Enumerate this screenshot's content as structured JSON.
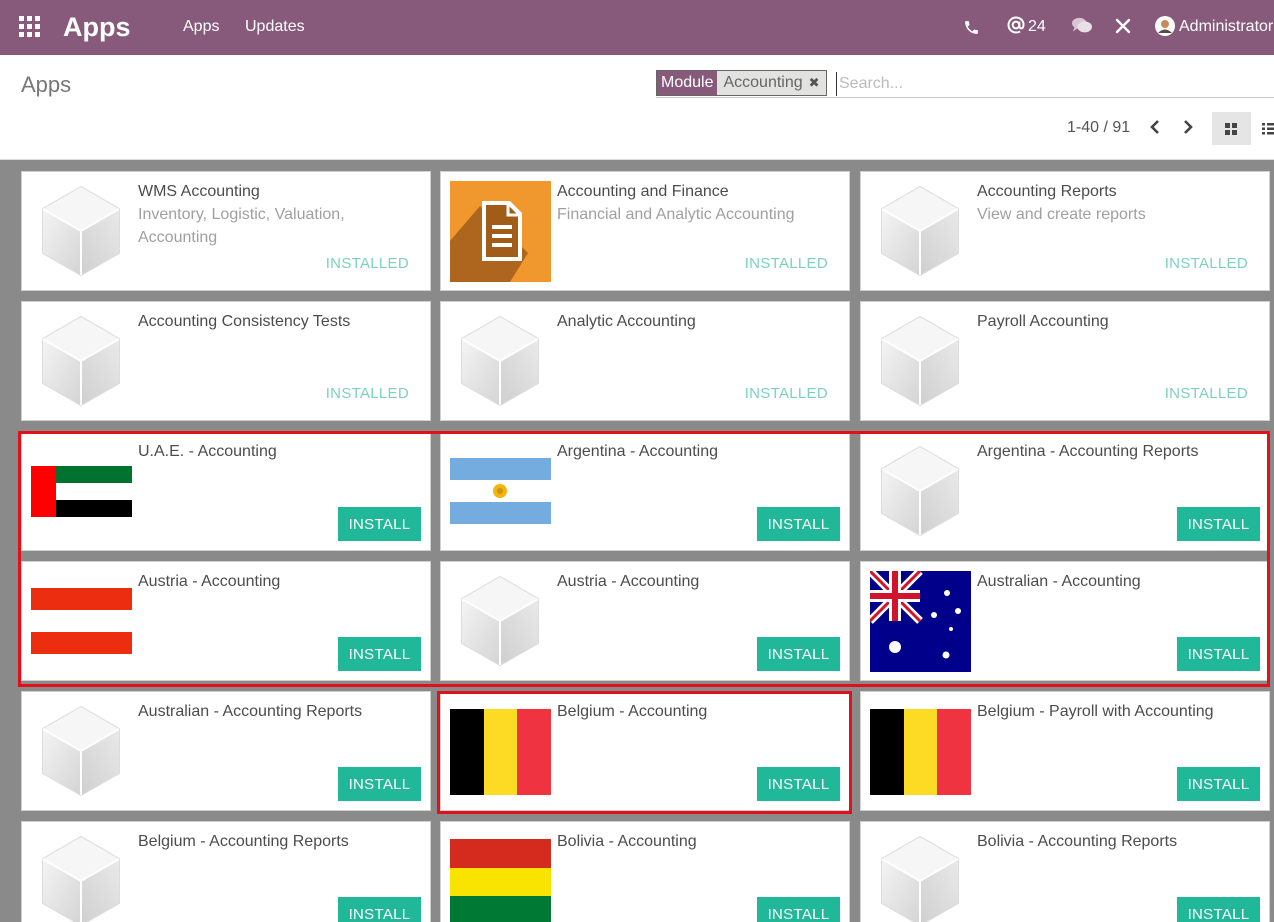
{
  "navbar": {
    "brand": "Apps",
    "menu": [
      "Apps",
      "Updates"
    ],
    "messages_count": "24",
    "user_name": "Administrator",
    "icons": [
      "apps-grid-icon",
      "phone-icon",
      "at-icon",
      "chat-icon",
      "debug-tools-icon",
      "user-avatar"
    ]
  },
  "control_panel": {
    "title": "Apps",
    "facet_category": "Module",
    "facet_value": "Accounting",
    "search_placeholder": "Search...",
    "pager_value": "1-40 / 91"
  },
  "colors": {
    "navbar": "#875a7b",
    "install_button": "#21b799",
    "installed_text": "#7bd1c0",
    "highlight": "#e0101c"
  },
  "install_label": "INSTALL",
  "installed_label": "INSTALLED",
  "apps": [
    {
      "name": "WMS Accounting",
      "summary": "Inventory, Logistic, Valuation, Accounting",
      "state": "installed",
      "logo": "default-cube"
    },
    {
      "name": "Accounting and Finance",
      "summary": "Financial and Analytic Accounting",
      "state": "installed",
      "logo": "accounting-document"
    },
    {
      "name": "Accounting Reports",
      "summary": "View and create reports",
      "state": "installed",
      "logo": "default-cube"
    },
    {
      "name": "Accounting Consistency Tests",
      "summary": "",
      "state": "installed",
      "logo": "default-cube"
    },
    {
      "name": "Analytic Accounting",
      "summary": "",
      "state": "installed",
      "logo": "default-cube"
    },
    {
      "name": "Payroll Accounting",
      "summary": "",
      "state": "installed",
      "logo": "default-cube"
    },
    {
      "name": "U.A.E. - Accounting",
      "summary": "",
      "state": "install",
      "logo": "flag-uae"
    },
    {
      "name": "Argentina - Accounting",
      "summary": "",
      "state": "install",
      "logo": "flag-argentina"
    },
    {
      "name": "Argentina - Accounting Reports",
      "summary": "",
      "state": "install",
      "logo": "default-cube"
    },
    {
      "name": "Austria - Accounting",
      "summary": "",
      "state": "install",
      "logo": "flag-austria"
    },
    {
      "name": "Austria - Accounting",
      "summary": "",
      "state": "install",
      "logo": "default-cube"
    },
    {
      "name": "Australian - Accounting",
      "summary": "",
      "state": "install",
      "logo": "flag-australia"
    },
    {
      "name": "Australian - Accounting Reports",
      "summary": "",
      "state": "install",
      "logo": "default-cube"
    },
    {
      "name": "Belgium - Accounting",
      "summary": "",
      "state": "install",
      "logo": "flag-belgium"
    },
    {
      "name": "Belgium - Payroll with Accounting",
      "summary": "",
      "state": "install",
      "logo": "flag-belgium"
    },
    {
      "name": "Belgium - Accounting Reports",
      "summary": "",
      "state": "install",
      "logo": "default-cube"
    },
    {
      "name": "Bolivia - Accounting",
      "summary": "",
      "state": "install",
      "logo": "flag-bolivia"
    },
    {
      "name": "Bolivia - Accounting Reports",
      "summary": "",
      "state": "install",
      "logo": "default-cube"
    }
  ]
}
